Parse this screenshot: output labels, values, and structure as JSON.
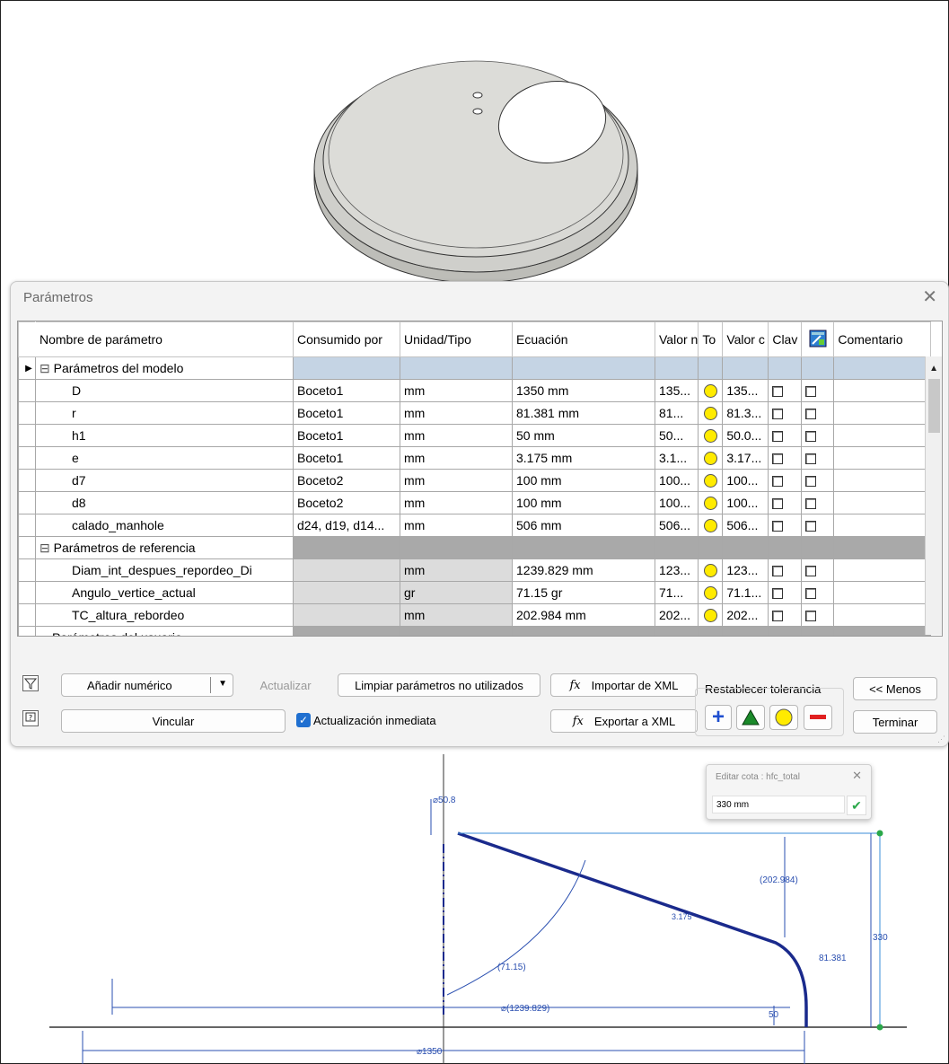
{
  "dialog": {
    "title": "Parámetros",
    "columns": [
      "Nombre de parámetro",
      "Consumido por",
      "Unidad/Tipo",
      "Ecuación",
      "Valor n",
      "To",
      "Valor c",
      "Clav",
      "",
      "Comentario"
    ],
    "groups": [
      {
        "name": "Parámetros del modelo",
        "rows": [
          {
            "name": "D",
            "consumed": "Boceto1",
            "unit": "mm",
            "equation": "1350 mm",
            "nominal": "135...",
            "value": "135..."
          },
          {
            "name": "r",
            "consumed": "Boceto1",
            "unit": "mm",
            "equation": "81.381 mm",
            "nominal": "81...",
            "value": "81.3..."
          },
          {
            "name": "h1",
            "consumed": "Boceto1",
            "unit": "mm",
            "equation": "50 mm",
            "nominal": "50...",
            "value": "50.0..."
          },
          {
            "name": "e",
            "consumed": "Boceto1",
            "unit": "mm",
            "equation": "3.175 mm",
            "nominal": "3.1...",
            "value": "3.17..."
          },
          {
            "name": "d7",
            "consumed": "Boceto2",
            "unit": "mm",
            "equation": "100 mm",
            "nominal": "100...",
            "value": "100..."
          },
          {
            "name": "d8",
            "consumed": "Boceto2",
            "unit": "mm",
            "equation": "100 mm",
            "nominal": "100...",
            "value": "100..."
          },
          {
            "name": "calado_manhole",
            "consumed": "d24, d19, d14...",
            "unit": "mm",
            "equation": "506 mm",
            "nominal": "506...",
            "value": "506..."
          }
        ]
      },
      {
        "name": "Parámetros de referencia",
        "rows": [
          {
            "name": "Diam_int_despues_repordeo_Di",
            "consumed": "",
            "unit": "mm",
            "equation": "1239.829 mm",
            "nominal": "123...",
            "value": "123..."
          },
          {
            "name": "Angulo_vertice_actual",
            "consumed": "",
            "unit": "gr",
            "equation": "71.15 gr",
            "nominal": "71...",
            "value": "71.1..."
          },
          {
            "name": "TC_altura_rebordeo",
            "consumed": "",
            "unit": "mm",
            "equation": "202.984 mm",
            "nominal": "202...",
            "value": "202..."
          }
        ]
      },
      {
        "name": "Parámetros del usuario",
        "rows": []
      }
    ],
    "buttons": {
      "add_numeric": "Añadir numérico",
      "update": "Actualizar",
      "purge": "Limpiar parámetros no utilizados",
      "import_xml": "Importar de XML",
      "export_xml": "Exportar a XML",
      "link": "Vincular",
      "immediate_update": "Actualización inmediata",
      "reset_tolerance": "Restablecer tolerancia",
      "less": "<< Menos",
      "done": "Terminar"
    }
  },
  "popup": {
    "title": "Editar cota : hfc_total",
    "value": "330 mm"
  },
  "sketch": {
    "dims": {
      "top_dia": "⌀50.8",
      "height_ref": "(202.984)",
      "total_height": "330",
      "thickness": "3.175",
      "radius": "81.381",
      "angle": "(71.15)",
      "inner_dia": "⌀(1239.829)",
      "h1": "50",
      "outer_dia": "⌀1350"
    }
  },
  "colors": {
    "sketch_blue": "#1a2a8c",
    "dim_blue": "#2a4fb0",
    "constraint_blue": "#3a8ed8",
    "tolerance_yellow": "#ffeb00"
  }
}
